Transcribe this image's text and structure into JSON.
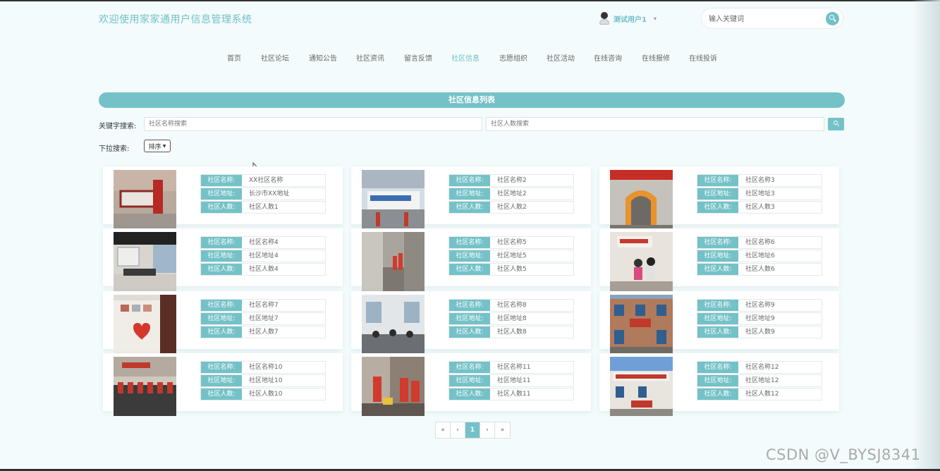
{
  "header": {
    "title": "欢迎使用家家通用户信息管理系统",
    "user_name": "测试用户1",
    "search_placeholder": "输入关键词"
  },
  "nav": {
    "items": [
      {
        "label": "首页",
        "active": false
      },
      {
        "label": "社区论坛",
        "active": false
      },
      {
        "label": "通知公告",
        "active": false
      },
      {
        "label": "社区资讯",
        "active": false
      },
      {
        "label": "留言反馈",
        "active": false
      },
      {
        "label": "社区信息",
        "active": true
      },
      {
        "label": "志愿组织",
        "active": false
      },
      {
        "label": "社区活动",
        "active": false
      },
      {
        "label": "在线咨询",
        "active": false
      },
      {
        "label": "在线报修",
        "active": false
      },
      {
        "label": "在线投诉",
        "active": false
      }
    ]
  },
  "section": {
    "title": "社区信息列表"
  },
  "filters": {
    "keyword_label": "关键字搜索:",
    "name_placeholder": "社区名称搜索",
    "count_placeholder": "社区人数搜索",
    "dropdown_label": "下拉搜索:",
    "sort_label": "排序"
  },
  "labels": {
    "name": "社区名称:",
    "address": "社区地址:",
    "count": "社区人数:"
  },
  "communities": [
    {
      "name": "XX社区名称",
      "address": "长沙市XX地址",
      "count": "社区人数1"
    },
    {
      "name": "社区名称2",
      "address": "社区地址2",
      "count": "社区人数2"
    },
    {
      "name": "社区名称3",
      "address": "社区地址3",
      "count": "社区人数3"
    },
    {
      "name": "社区名称4",
      "address": "社区地址4",
      "count": "社区人数4"
    },
    {
      "name": "社区名称5",
      "address": "社区地址5",
      "count": "社区人数5"
    },
    {
      "name": "社区名称6",
      "address": "社区地址6",
      "count": "社区人数6"
    },
    {
      "name": "社区名称7",
      "address": "社区地址7",
      "count": "社区人数7"
    },
    {
      "name": "社区名称8",
      "address": "社区地址8",
      "count": "社区人数8"
    },
    {
      "name": "社区名称9",
      "address": "社区地址9",
      "count": "社区人数9"
    },
    {
      "name": "社区名称10",
      "address": "社区地址10",
      "count": "社区人数10"
    },
    {
      "name": "社区名称11",
      "address": "社区地址11",
      "count": "社区人数11"
    },
    {
      "name": "社区名称12",
      "address": "社区地址12",
      "count": "社区人数12"
    }
  ],
  "pagination": {
    "first": "«",
    "prev": "‹",
    "current": "1",
    "next": "›",
    "last": "»"
  },
  "watermark": "CSDN @V_BYSJ8341",
  "colors": {
    "accent": "#74c2c8",
    "background": "#f4fbfc"
  }
}
